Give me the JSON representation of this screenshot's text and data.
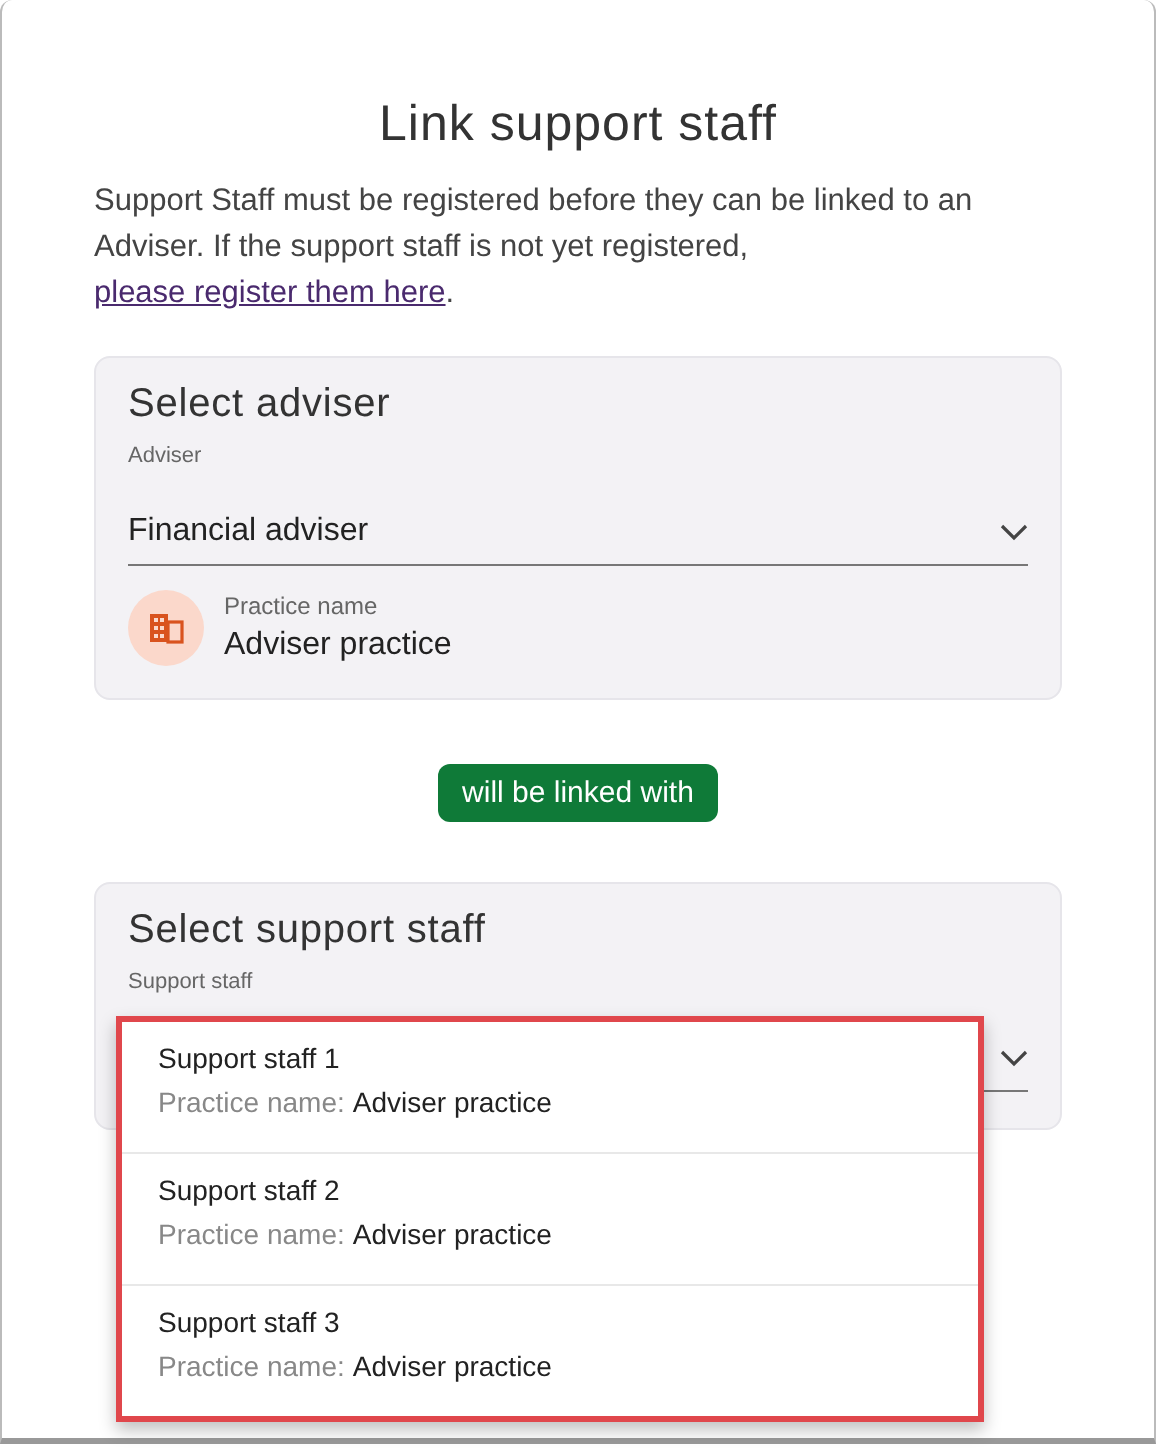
{
  "dialog": {
    "title": "Link support staff",
    "intro": "Support Staff must be registered before they can be linked to an Adviser. If the support staff is not yet registered, ",
    "intro_link": "please register them here",
    "intro_end": "."
  },
  "adviser_card": {
    "heading": "Select adviser",
    "field_label": "Adviser",
    "value": "Financial adviser",
    "practice_label": "Practice name",
    "practice_value": "Adviser practice"
  },
  "link_badge": "will be linked with",
  "staff_card": {
    "heading": "Select support staff",
    "field_label": "Support staff",
    "expanded": true,
    "options": [
      {
        "name": "Support staff 1",
        "practice_label": "Practice name:",
        "practice_value": "Adviser practice"
      },
      {
        "name": "Support staff 2",
        "practice_label": "Practice name:",
        "practice_value": "Adviser practice"
      },
      {
        "name": "Support staff 3",
        "practice_label": "Practice name:",
        "practice_value": "Adviser practice"
      }
    ]
  }
}
